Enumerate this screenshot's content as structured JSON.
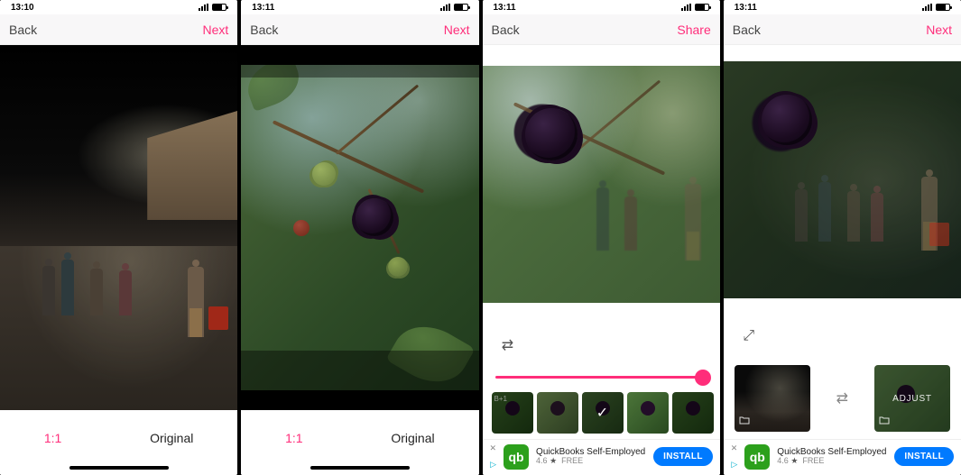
{
  "status": {
    "time": "13:11",
    "time_alt": "13:10"
  },
  "nav": {
    "back": "Back",
    "next": "Next",
    "share": "Share"
  },
  "aspect": {
    "one_one": "1:1",
    "original": "Original"
  },
  "screen3": {
    "swap_icon": "⇄",
    "filter_thumbs": [
      {
        "label": "B+1",
        "variant": "dark",
        "selected": false
      },
      {
        "label": "",
        "variant": "warm",
        "selected": false
      },
      {
        "label": "",
        "variant": "",
        "selected": true
      },
      {
        "label": "",
        "variant": "light",
        "selected": false
      },
      {
        "label": "",
        "variant": "dark",
        "selected": false
      }
    ],
    "slider_value": 100
  },
  "screen4": {
    "expand_icon": "⤢",
    "swap_icon": "⇄",
    "left_thumb_folder": "folder",
    "right_thumb_folder": "folder",
    "adjust_label": "ADJUST"
  },
  "ad": {
    "close": "✕",
    "info": "▷",
    "icon_letter": "qb",
    "title": "QuickBooks Self-Employed",
    "rating": "4.6",
    "star": "★",
    "price": "FREE",
    "cta": "INSTALL"
  }
}
